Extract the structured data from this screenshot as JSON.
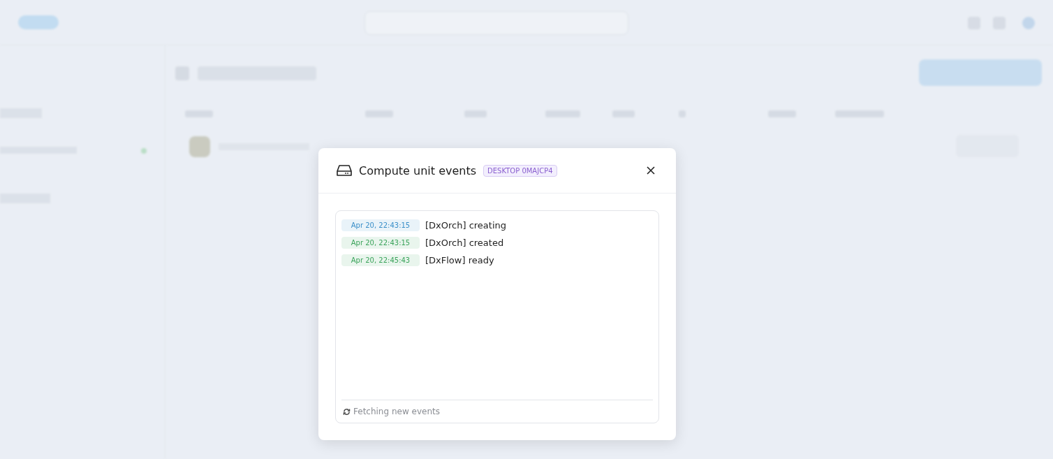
{
  "dialog": {
    "title": "Compute unit events",
    "tag": "DESKTOP 0MAJCP4",
    "events": [
      {
        "time": "Apr 20, 22:43:15",
        "message": "[DxOrch] creating",
        "color": "#3a8fc9"
      },
      {
        "time": "Apr 20, 22:43:15",
        "message": "[DxOrch] created",
        "color": "#3aa35a"
      },
      {
        "time": "Apr 20, 22:45:43",
        "message": "[DxFlow] ready",
        "color": "#3aa35a"
      }
    ],
    "status": "Fetching new events"
  }
}
